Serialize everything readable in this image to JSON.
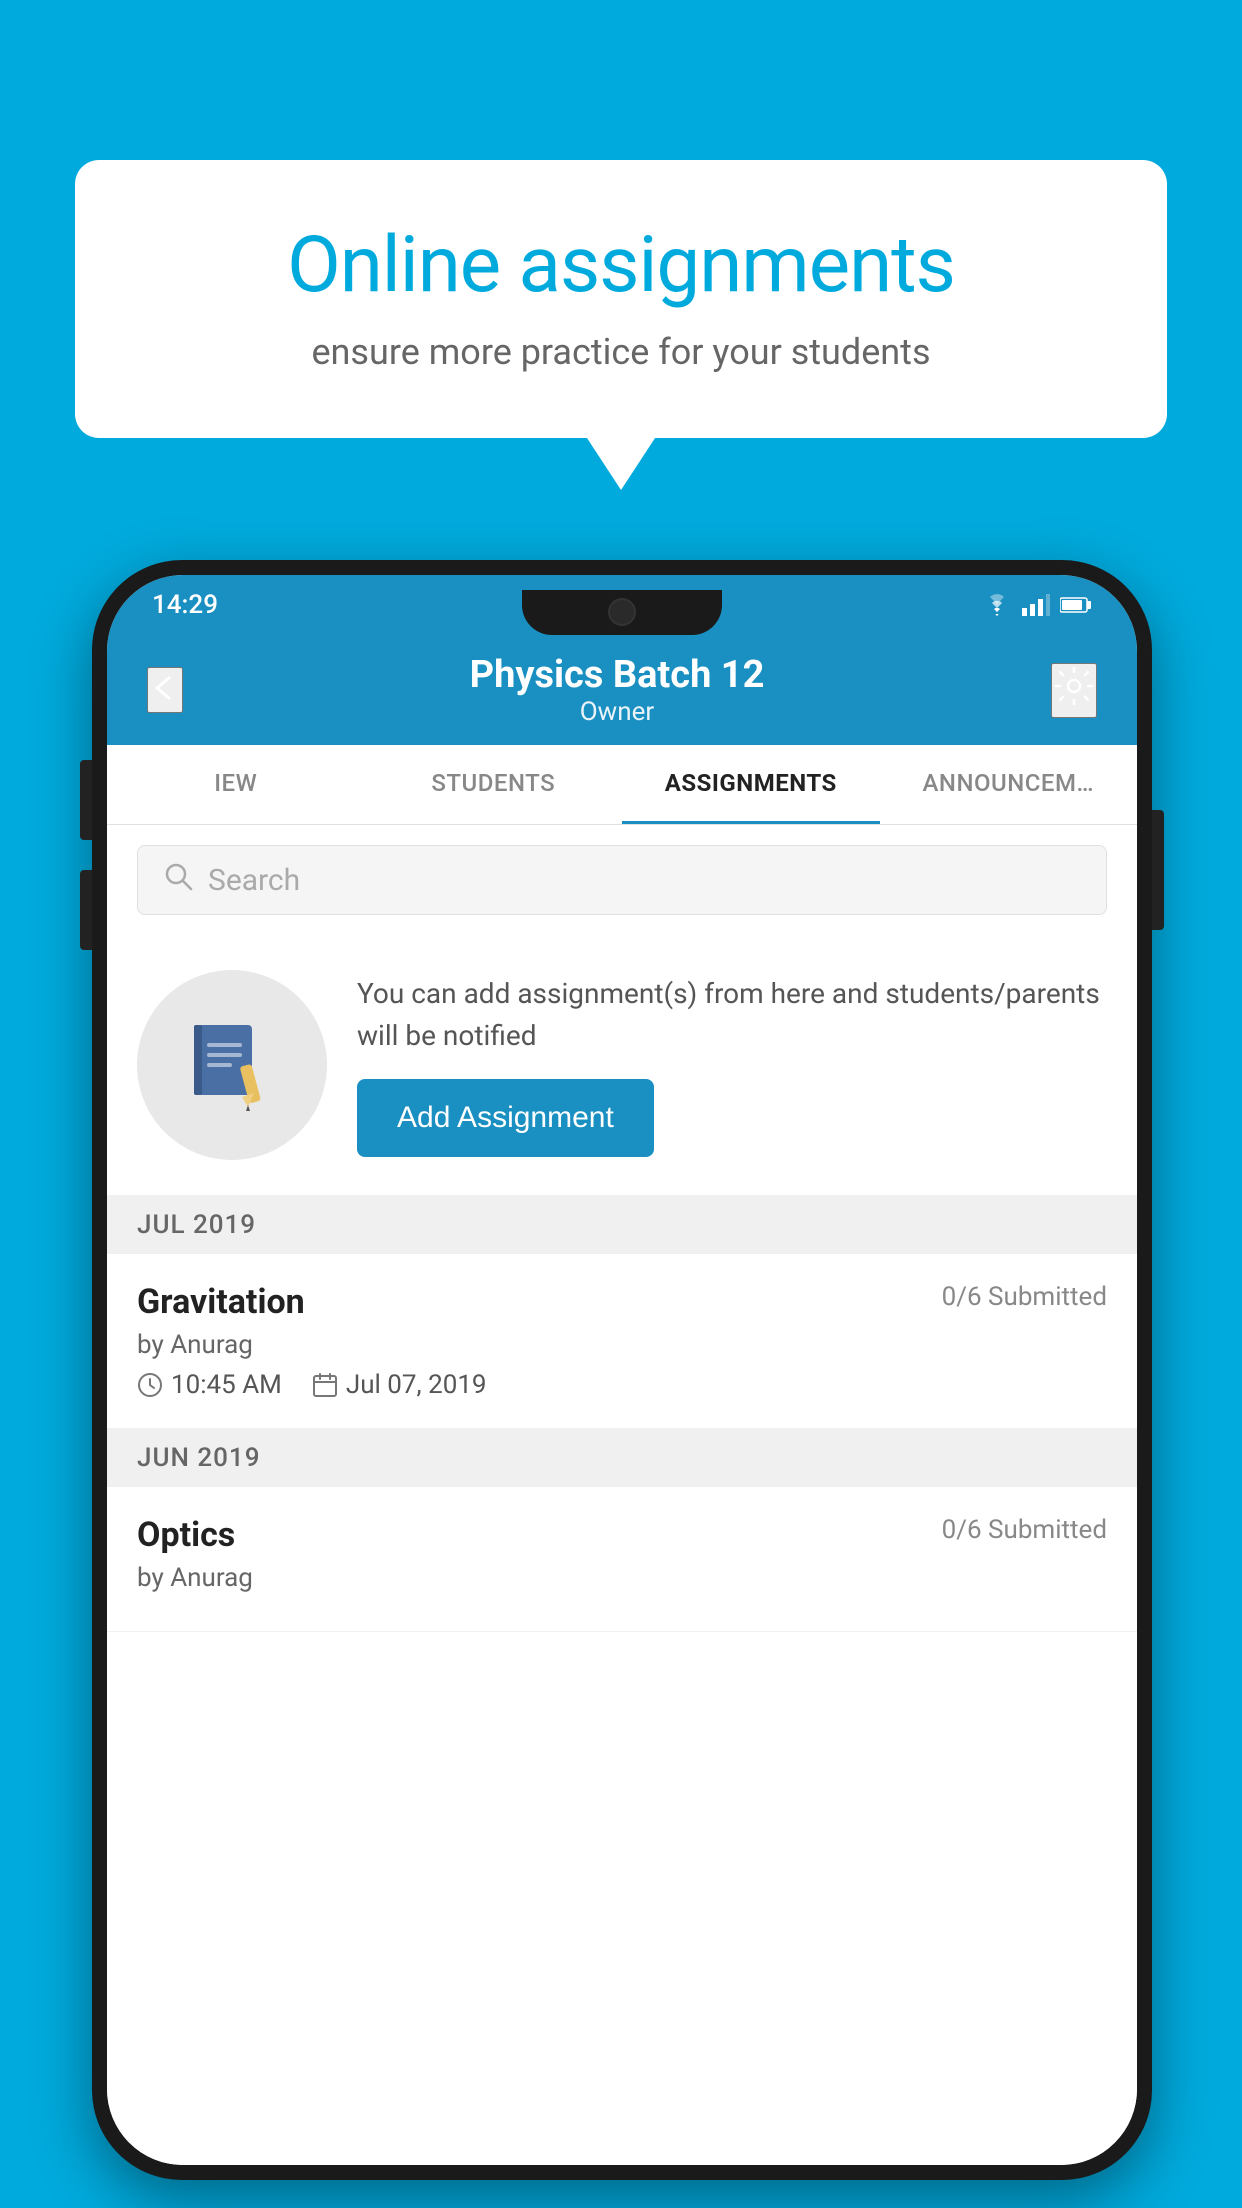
{
  "background_color": "#00AADD",
  "speech_bubble": {
    "title": "Online assignments",
    "subtitle": "ensure more practice for your students"
  },
  "status_bar": {
    "time": "14:29",
    "icons": [
      "wifi",
      "signal",
      "battery"
    ]
  },
  "header": {
    "title": "Physics Batch 12",
    "subtitle": "Owner",
    "back_label": "←",
    "settings_label": "⚙"
  },
  "tabs": [
    {
      "label": "IEW",
      "active": false
    },
    {
      "label": "STUDENTS",
      "active": false
    },
    {
      "label": "ASSIGNMENTS",
      "active": true
    },
    {
      "label": "ANNOUNCEM…",
      "active": false
    }
  ],
  "search": {
    "placeholder": "Search"
  },
  "add_assignment": {
    "description": "You can add assignment(s) from here and students/parents will be notified",
    "button_label": "Add Assignment"
  },
  "sections": [
    {
      "label": "JUL 2019",
      "assignments": [
        {
          "name": "Gravitation",
          "submitted": "0/6 Submitted",
          "author": "by Anurag",
          "time": "10:45 AM",
          "date": "Jul 07, 2019"
        }
      ]
    },
    {
      "label": "JUN 2019",
      "assignments": [
        {
          "name": "Optics",
          "submitted": "0/6 Submitted",
          "author": "by Anurag",
          "time": "",
          "date": ""
        }
      ]
    }
  ]
}
